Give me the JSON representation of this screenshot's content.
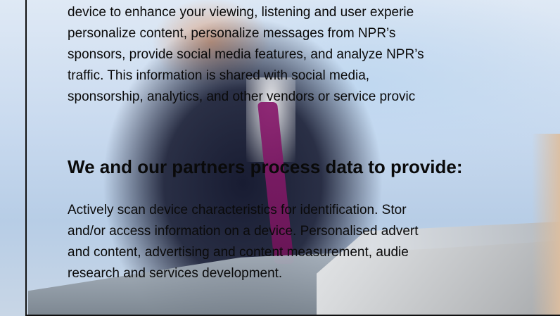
{
  "consent": {
    "intro_lines": [
      "device to enhance your viewing, listening and user experie",
      "personalize content, personalize messages from NPR’s",
      "sponsors, provide social media features, and analyze NPR’s",
      "traffic. This information is shared with social media,",
      "sponsorship, analytics, and other vendors or service provic"
    ],
    "heading": "We and our partners process data to provide:",
    "purposes_lines": [
      "Actively scan device characteristics for identification. Stor",
      "and/or access information on a device. Personalised advert",
      "and content, advertising and content measurement, audie",
      "research and services development."
    ]
  },
  "colors": {
    "text": "#0a0a0a",
    "frame": "#111111"
  }
}
